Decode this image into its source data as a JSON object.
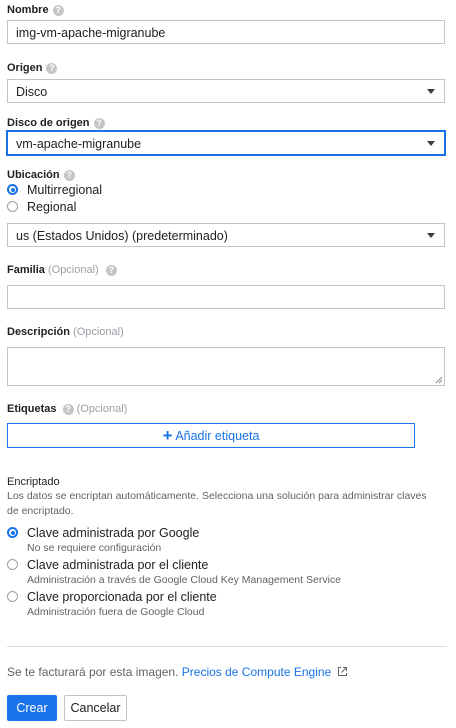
{
  "nombre": {
    "label": "Nombre",
    "help": "?",
    "value": "img-vm-apache-migranube"
  },
  "origen": {
    "label": "Origen",
    "help": "?",
    "value": "Disco"
  },
  "disco": {
    "label": "Disco de origen",
    "help": "?",
    "value": "vm-apache-migranube"
  },
  "ubicacion": {
    "label": "Ubicación",
    "help": "?",
    "options": [
      "Multirregional",
      "Regional"
    ],
    "selected": "Multirregional",
    "location_value": "us (Estados Unidos) (predeterminado)"
  },
  "familia": {
    "label": "Familia",
    "optional": "(Opcional)",
    "help": "?",
    "value": ""
  },
  "descripcion": {
    "label": "Descripción",
    "optional": "(Opcional)",
    "value": ""
  },
  "etiquetas": {
    "label": "Etiquetas",
    "optional": "(Opcional)",
    "help": "?",
    "add_icon": "+",
    "add_label": "Añadir etiqueta"
  },
  "encriptado": {
    "title": "Encriptado",
    "description": "Los datos se encriptan automáticamente. Selecciona una solución para administrar claves de encriptado.",
    "options": [
      {
        "label": "Clave administrada por Google",
        "sub": "No se requiere configuración"
      },
      {
        "label": "Clave administrada por el cliente",
        "sub": "Administración a través de Google Cloud Key Management Service"
      },
      {
        "label": "Clave proporcionada por el cliente",
        "sub": "Administración fuera de Google Cloud"
      }
    ],
    "selected_index": 0
  },
  "billing": {
    "text": "Se te facturará por esta imagen.",
    "link": "Precios de Compute Engine"
  },
  "actions": {
    "create": "Crear",
    "cancel": "Cancelar"
  },
  "colors": {
    "accent": "#1a73e8",
    "border": "#c4c4c4",
    "muted": "#5f6368"
  }
}
